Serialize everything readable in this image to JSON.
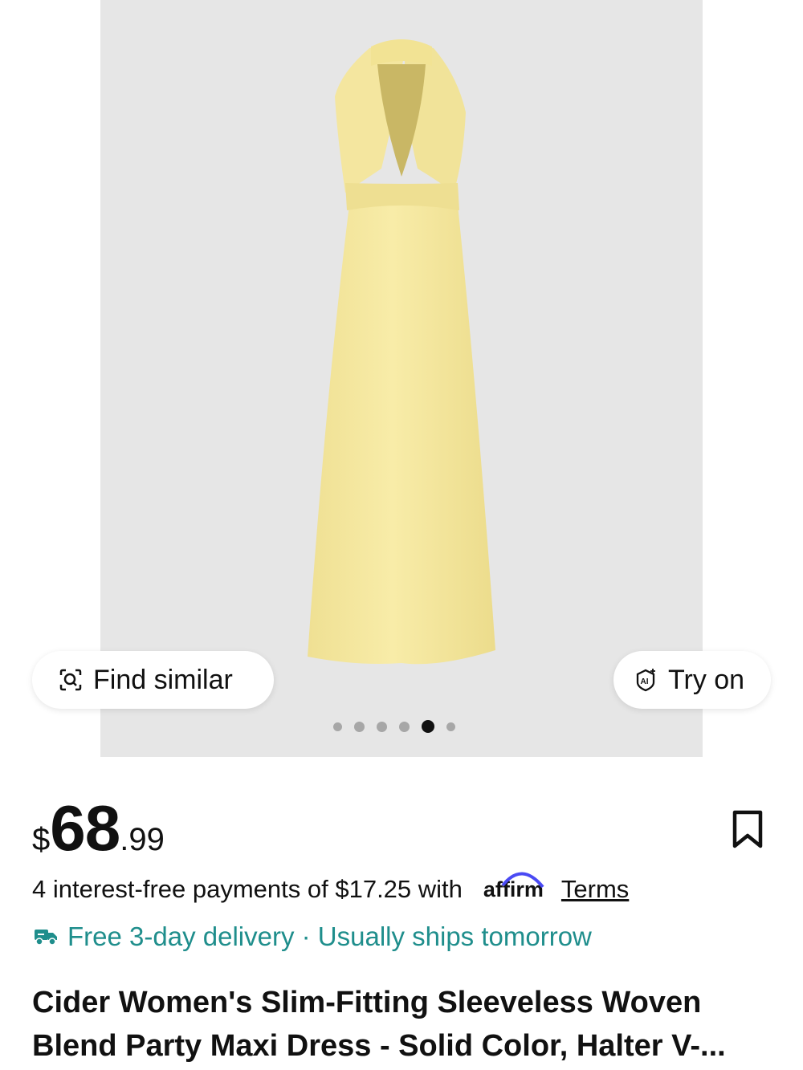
{
  "product_image": {
    "background_color": "#e6e6e6",
    "dress_color": "#f6e9a3",
    "carousel": {
      "total": 6,
      "active_index": 4
    }
  },
  "actions": {
    "find_similar_label": "Find similar",
    "find_similar_icon": "image-search-icon",
    "try_on_label": "Try on",
    "try_on_icon": "ai-sparkle-icon"
  },
  "price": {
    "currency": "$",
    "whole": "68",
    "cents": ".99"
  },
  "bookmark_icon": "bookmark-icon",
  "payments": {
    "text": "4 interest-free payments of $17.25 with",
    "provider": "affirm",
    "terms_label": "Terms"
  },
  "delivery": {
    "icon": "truck-icon",
    "text": "Free 3-day delivery · Usually ships tomorrow",
    "color": "#1f8e8c"
  },
  "title": {
    "line1": "Cider Women's Slim-Fitting Sleeveless Woven",
    "line2": "Blend Party Maxi Dress - Solid Color, Halter V-..."
  }
}
